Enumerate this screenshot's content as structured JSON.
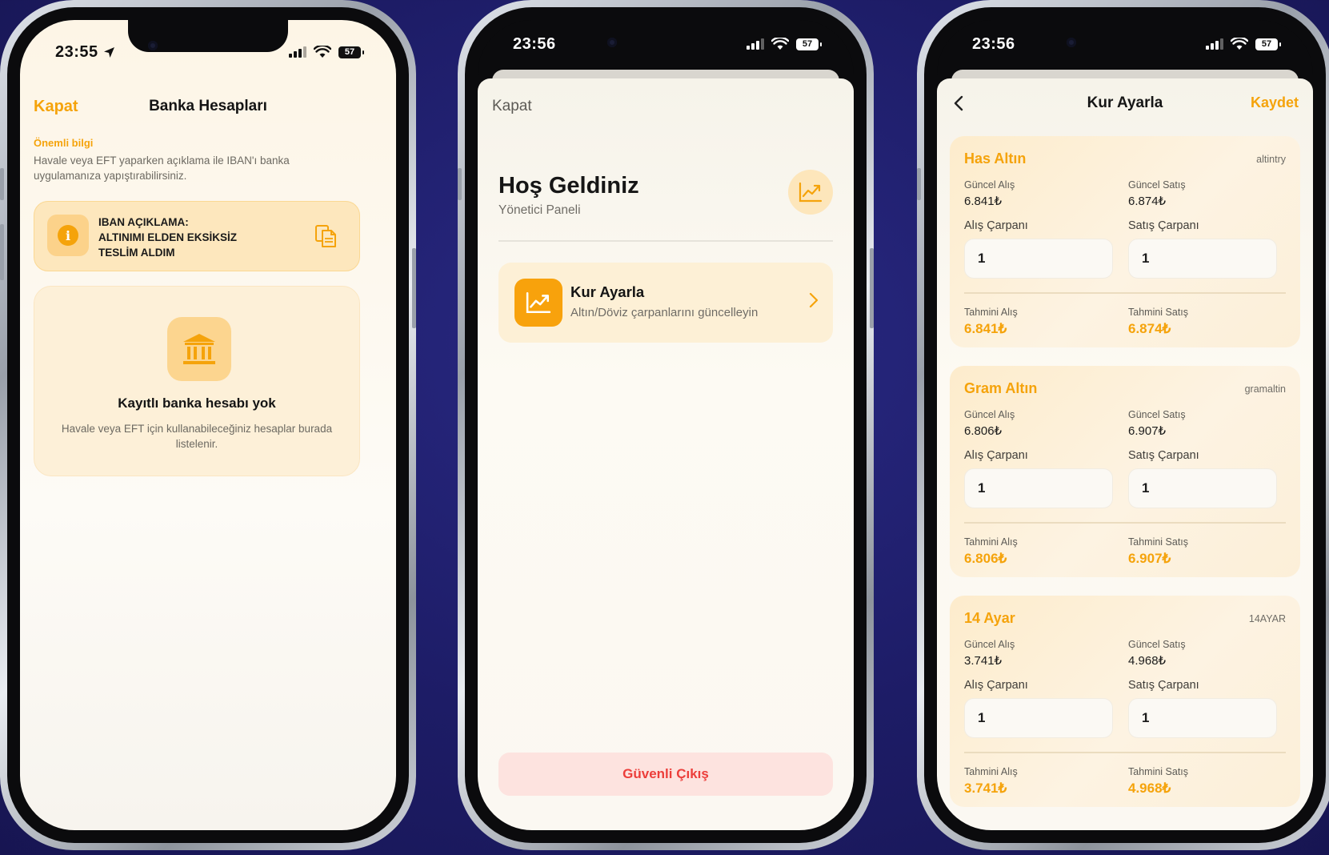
{
  "phone1": {
    "status": {
      "time": "23:55",
      "battery": "57"
    },
    "nav": {
      "close": "Kapat",
      "title": "Banka Hesapları"
    },
    "info": {
      "title": "Önemli bilgi",
      "text": "Havale veya EFT yaparken açıklama ile IBAN'ı banka uygulamanıza yapıştırabilirsiniz."
    },
    "iban": {
      "line1": "IBAN AÇIKLAMA:",
      "line2": "ALTINIMI ELDEN EKSİKSİZ",
      "line3": "TESLİM ALDIM"
    },
    "empty": {
      "title": "Kayıtlı banka hesabı yok",
      "desc": "Havale veya EFT için kullanabileceğiniz hesaplar burada listelenir."
    }
  },
  "phone2": {
    "status": {
      "time": "23:56",
      "battery": "57"
    },
    "close": "Kapat",
    "title": "Hoş Geldiniz",
    "subtitle": "Yönetici Paneli",
    "menu": {
      "title": "Kur Ayarla",
      "subtitle": "Altın/Döviz çarpanlarını güncelleyin"
    },
    "exit": "Güvenli Çıkış"
  },
  "phone3": {
    "status": {
      "time": "23:56",
      "battery": "57"
    },
    "nav": {
      "title": "Kur Ayarla",
      "save": "Kaydet"
    },
    "labels": {
      "buy": "Güncel Alış",
      "sell": "Güncel Satış",
      "buy_mult": "Alış Çarpanı",
      "sell_mult": "Satış Çarpanı",
      "est_buy": "Tahmini Alış",
      "est_sell": "Tahmini Satış"
    },
    "cards": [
      {
        "name": "Has Altın",
        "code": "altintry",
        "buy": "6.841₺",
        "sell": "6.874₺",
        "buy_mult": "1",
        "sell_mult": "1",
        "est_buy": "6.841₺",
        "est_sell": "6.874₺"
      },
      {
        "name": "Gram Altın",
        "code": "gramaltin",
        "buy": "6.806₺",
        "sell": "6.907₺",
        "buy_mult": "1",
        "sell_mult": "1",
        "est_buy": "6.806₺",
        "est_sell": "6.907₺"
      },
      {
        "name": "14 Ayar",
        "code": "14AYAR",
        "buy": "3.741₺",
        "sell": "4.968₺",
        "buy_mult": "1",
        "sell_mult": "1",
        "est_buy": "3.741₺",
        "est_sell": "4.968₺"
      }
    ]
  },
  "colors": {
    "accent": "#f5a30b",
    "danger": "#ec3e3a",
    "background": "#1d1c66"
  }
}
